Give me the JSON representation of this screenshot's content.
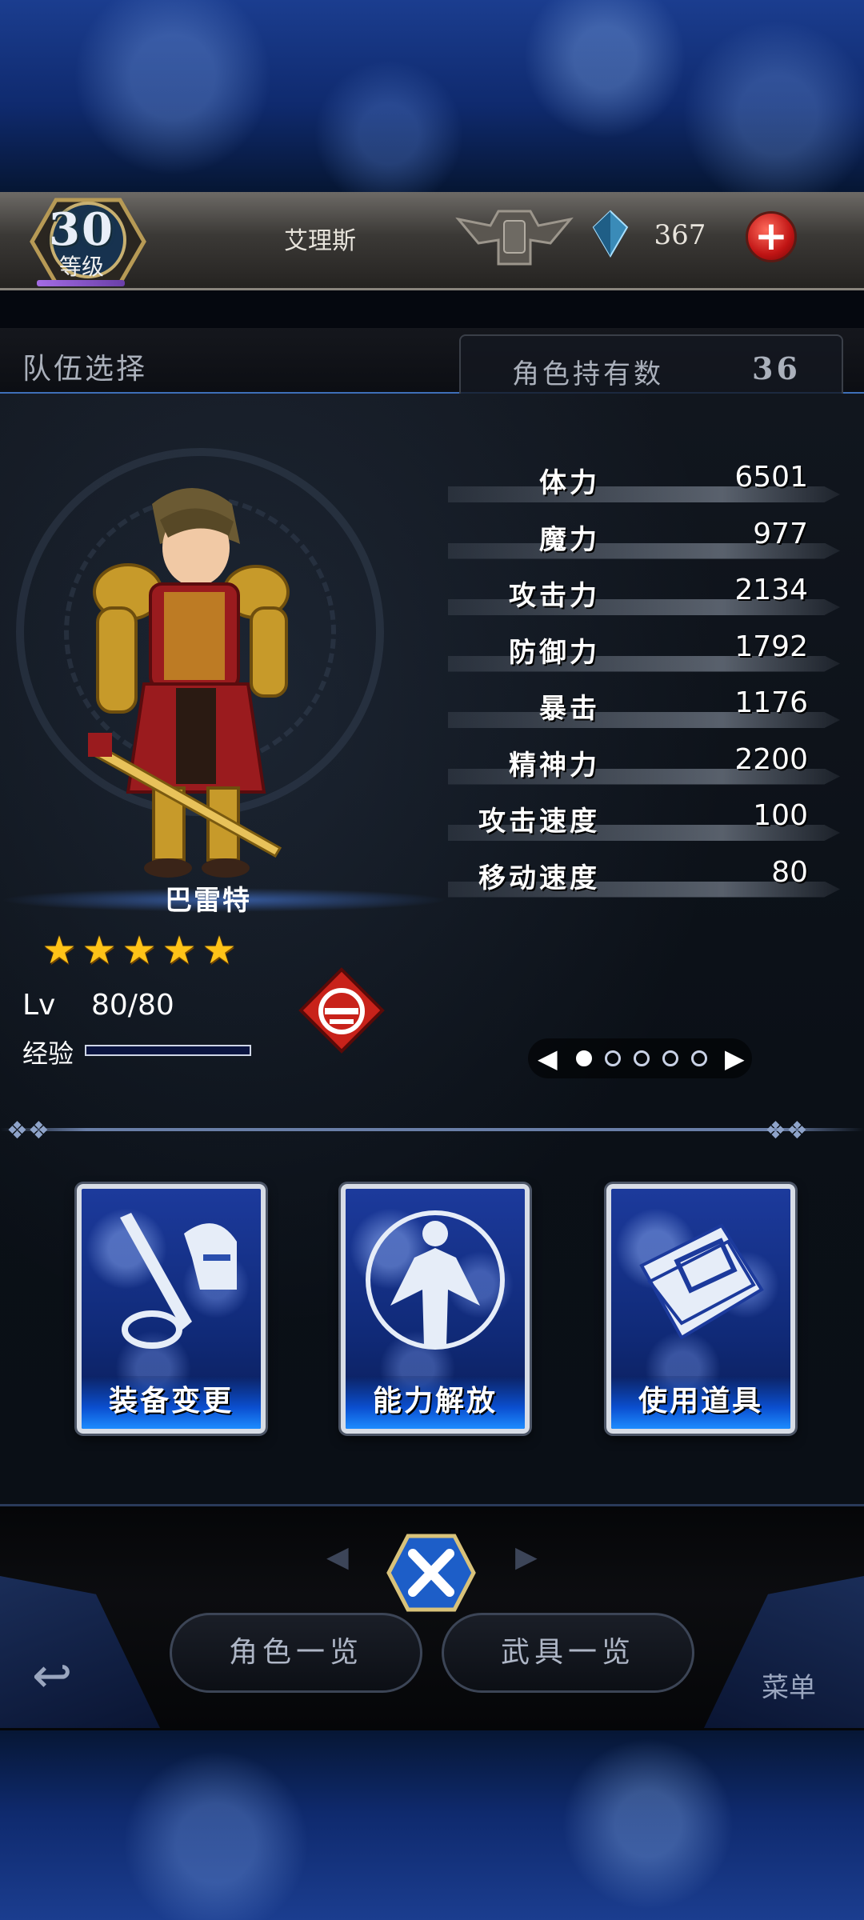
{
  "header": {
    "level": "30",
    "level_label": "等级",
    "player_name": "艾理斯",
    "gem_count": "367",
    "add_symbol": "+"
  },
  "team": {
    "title": "队伍选择",
    "owned_label": "角色持有数",
    "owned_count": "36"
  },
  "hero": {
    "name": "巴雷特",
    "stars": 5,
    "star_glyph": "★",
    "lv_label": "Lv",
    "lv_value": "80/80",
    "exp_label": "经验"
  },
  "stats": [
    {
      "label": "体力",
      "value": "6501"
    },
    {
      "label": "魔力",
      "value": "977"
    },
    {
      "label": "攻击力",
      "value": "2134"
    },
    {
      "label": "防御力",
      "value": "1792"
    },
    {
      "label": "暴击",
      "value": "1176"
    },
    {
      "label": "精神力",
      "value": "2200"
    },
    {
      "label": "攻击速度",
      "value": "100"
    },
    {
      "label": "移动速度",
      "value": "80"
    }
  ],
  "pager": {
    "left": "◀",
    "right": "▶",
    "page_count": 5,
    "active_index": 0
  },
  "actions": [
    {
      "label": "装备变更",
      "icon": "equipment-icon"
    },
    {
      "label": "能力解放",
      "icon": "ability-release-icon"
    },
    {
      "label": "使用道具",
      "icon": "item-book-icon"
    }
  ],
  "nav": {
    "close_symbol": "✕",
    "character_list": "角色一览",
    "weapon_list": "武具一览",
    "menu": "菜单",
    "back_symbol": "↩"
  },
  "colors": {
    "accent_blue": "#1d8cff",
    "star_gold": "#ffc318",
    "add_red": "#c01414",
    "job_red": "#c8221a"
  }
}
